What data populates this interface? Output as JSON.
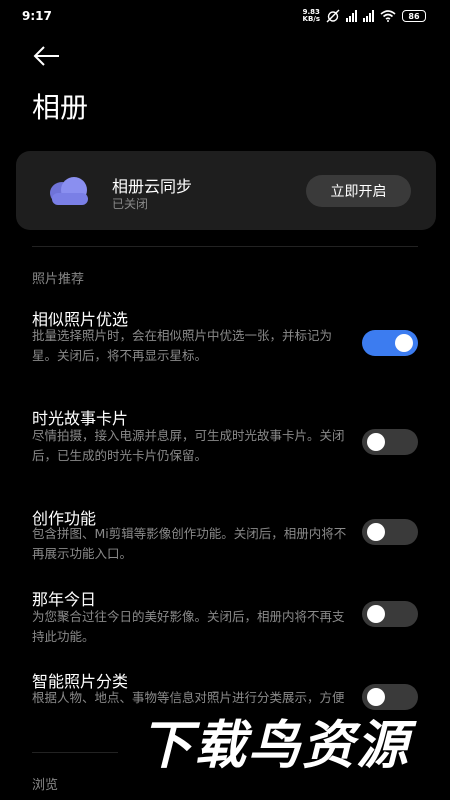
{
  "status": {
    "time": "9:17",
    "net_speed_value": "9.83",
    "net_speed_unit": "KB/s",
    "battery": "86"
  },
  "header": {
    "title": "相册"
  },
  "sync": {
    "title": "相册云同步",
    "subtitle": "已关闭",
    "button_label": "立即开启"
  },
  "sections": {
    "photo_recommend": "照片推荐",
    "browse": "浏览"
  },
  "items": [
    {
      "title": "相似照片优选",
      "desc": "批量选择照片时，会在相似照片中优选一张，并标记为星。关闭后，将不再显示星标。",
      "on": true
    },
    {
      "title": "时光故事卡片",
      "desc": "尽情拍摄，接入电源并息屏，可生成时光故事卡片。关闭后，已生成的时光卡片仍保留。",
      "on": false
    },
    {
      "title": "创作功能",
      "desc": "包含拼图、Mi剪辑等影像创作功能。关闭后，相册内将不再展示功能入口。",
      "on": false
    },
    {
      "title": "那年今日",
      "desc": "为您聚合过往今日的美好影像。关闭后，相册内将不再支持此功能。",
      "on": false
    },
    {
      "title": "智能照片分类",
      "desc": "根据人物、地点、事物等信息对照片进行分类展示，方便",
      "on": false
    }
  ],
  "watermark": "下载鸟资源",
  "colors": {
    "accent": "#3c7cf0",
    "background": "#000000",
    "card": "#1e1e1e"
  }
}
